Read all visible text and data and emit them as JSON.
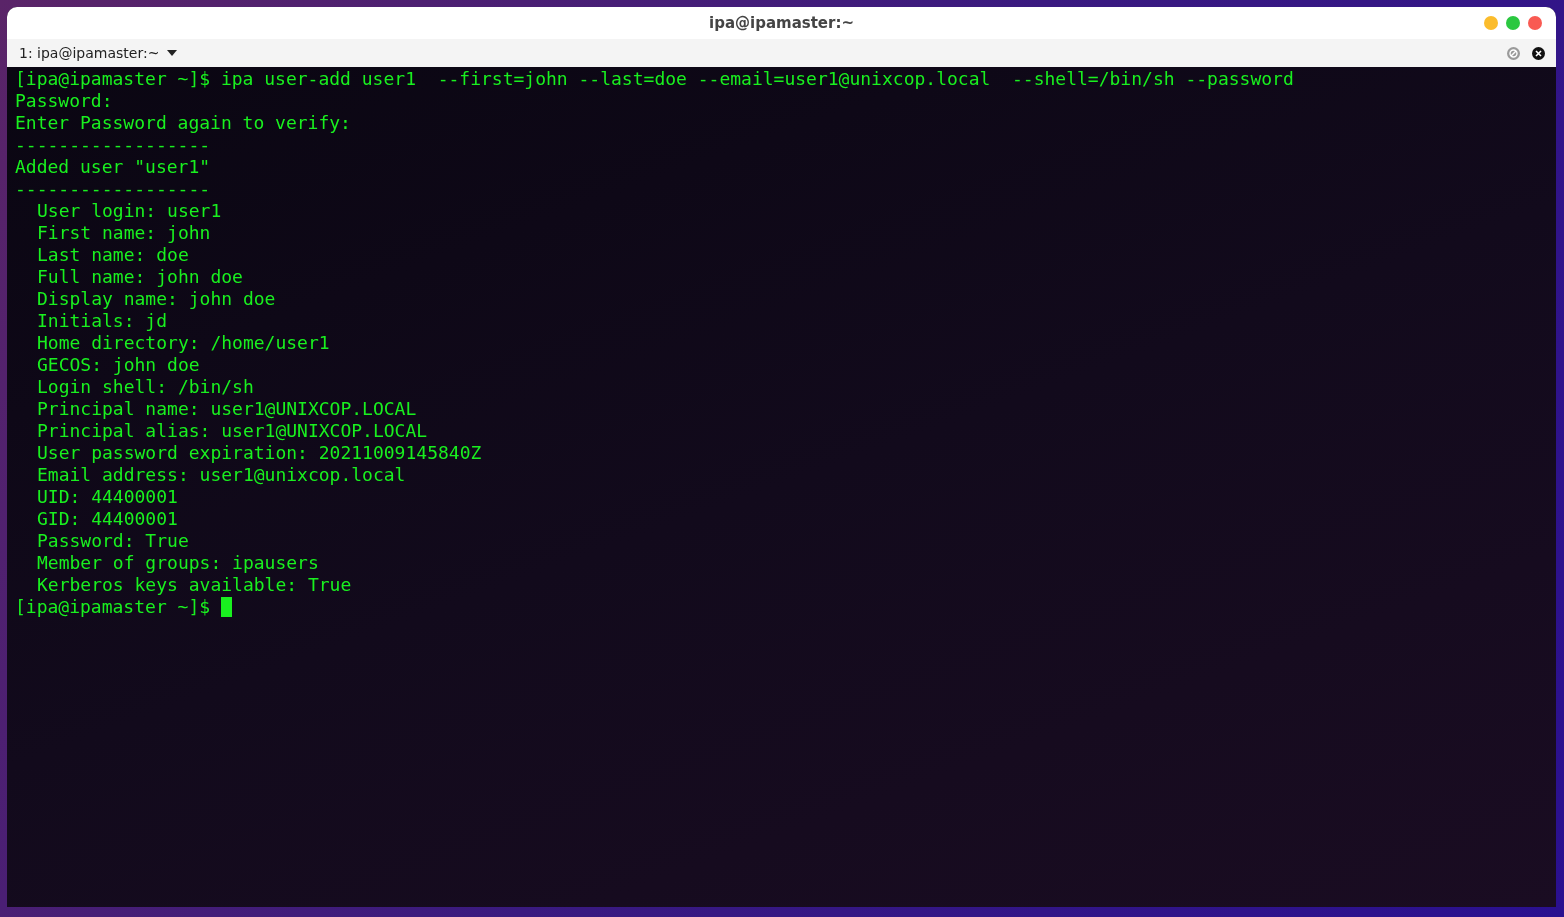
{
  "window": {
    "title": "ipa@ipamaster:~"
  },
  "tabs": [
    {
      "label": "1: ipa@ipamaster:~",
      "selected": true
    }
  ],
  "terminal": {
    "lines": [
      {
        "kind": "prompt",
        "prompt": "[ipa@ipamaster ~]$",
        "text": "ipa user-add user1  --first=john --last=doe --email=user1@unixcop.local  --shell=/bin/sh --password"
      },
      {
        "kind": "output",
        "text": "Password:"
      },
      {
        "kind": "output",
        "text": "Enter Password again to verify:"
      },
      {
        "kind": "output",
        "text": "------------------"
      },
      {
        "kind": "output",
        "text": "Added user \"user1\""
      },
      {
        "kind": "output",
        "text": "------------------"
      },
      {
        "kind": "field",
        "text": "User login: user1"
      },
      {
        "kind": "field",
        "text": "First name: john"
      },
      {
        "kind": "field",
        "text": "Last name: doe"
      },
      {
        "kind": "field",
        "text": "Full name: john doe"
      },
      {
        "kind": "field",
        "text": "Display name: john doe"
      },
      {
        "kind": "field",
        "text": "Initials: jd"
      },
      {
        "kind": "field",
        "text": "Home directory: /home/user1"
      },
      {
        "kind": "field",
        "text": "GECOS: john doe"
      },
      {
        "kind": "field",
        "text": "Login shell: /bin/sh"
      },
      {
        "kind": "field",
        "text": "Principal name: user1@UNIXCOP.LOCAL"
      },
      {
        "kind": "field",
        "text": "Principal alias: user1@UNIXCOP.LOCAL"
      },
      {
        "kind": "field",
        "text": "User password expiration: 20211009145840Z"
      },
      {
        "kind": "field",
        "text": "Email address: user1@unixcop.local"
      },
      {
        "kind": "field",
        "text": "UID: 44400001"
      },
      {
        "kind": "field",
        "text": "GID: 44400001"
      },
      {
        "kind": "field",
        "text": "Password: True"
      },
      {
        "kind": "field",
        "text": "Member of groups: ipausers"
      },
      {
        "kind": "field",
        "text": "Kerberos keys available: True"
      },
      {
        "kind": "cursor",
        "prompt": "[ipa@ipamaster ~]$"
      }
    ]
  }
}
